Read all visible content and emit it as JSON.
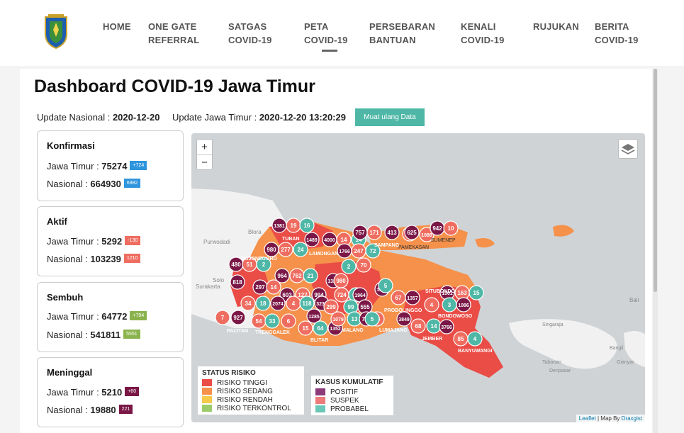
{
  "nav": {
    "items": [
      {
        "line1": "HOME",
        "line2": ""
      },
      {
        "line1": "ONE GATE",
        "line2": "REFERRAL"
      },
      {
        "line1": "SATGAS",
        "line2": "COVID-19"
      },
      {
        "line1": "PETA",
        "line2": "COVID-19"
      },
      {
        "line1": "PERSEBARAN",
        "line2": "BANTUAN"
      },
      {
        "line1": "KENALI",
        "line2": "COVID-19"
      },
      {
        "line1": "RUJUKAN",
        "line2": ""
      },
      {
        "line1": "BERITA",
        "line2": "COVID-19"
      }
    ]
  },
  "page": {
    "title": "Dashboard COVID-19 Jawa Timur",
    "update_nasional_label": "Update Nasional : ",
    "update_nasional_value": "2020-12-20",
    "update_jatim_label": "Update Jawa Timur : ",
    "update_jatim_value": "2020-12-20 13:20:29",
    "reload_label": "Muat ulang Data"
  },
  "cards": [
    {
      "title": "Konfirmasi",
      "jatim_label": "Jawa Timur : ",
      "jatim_value": "75274",
      "jatim_delta": "+724",
      "nas_label": "Nasional : ",
      "nas_value": "664930",
      "nas_delta": "6982",
      "color": "#2f95dc"
    },
    {
      "title": "Aktif",
      "jatim_label": "Jawa Timur : ",
      "jatim_value": "5292",
      "jatim_delta": "-130",
      "nas_label": "Nasional : ",
      "nas_value": "103239",
      "nas_delta": "1210",
      "color": "#ef6d60"
    },
    {
      "title": "Sembuh",
      "jatim_label": "Jawa Timur : ",
      "jatim_value": "64772",
      "jatim_delta": "+794",
      "nas_label": "Nasional : ",
      "nas_value": "541811",
      "nas_delta": "5551",
      "color": "#8bb34d"
    },
    {
      "title": "Meninggal",
      "jatim_label": "Jawa Timur : ",
      "jatim_value": "5210",
      "jatim_delta": "+60",
      "nas_label": "Nasional : ",
      "nas_value": "19880",
      "nas_delta": "221",
      "color": "#7a1746"
    }
  ],
  "map": {
    "zoom_in": "+",
    "zoom_out": "−",
    "attribution_leaflet": "Leaflet",
    "attribution_sep": " | Map By ",
    "attribution_draxgist": "Draxgist",
    "labels": {
      "blora": "Blora",
      "purwodadi": "Purwodadi",
      "solo": "Solo",
      "surakarta": "Surakarta",
      "bali": "Bali",
      "singaraja": "Singaraja",
      "tabanan": "Tabanan",
      "denpasar": "Denpasar",
      "bangli": "Bangli",
      "gianyar": "Gianyar",
      "sumenep": "SUMENEP",
      "pamekasan": "PAMEKASAN",
      "tuban": "TUBAN",
      "lamongan": "LAMONGAN",
      "bojonegoro": "BOJONEGORO",
      "pacitan": "PACITAN",
      "trenggalek": "TRENGGALEK",
      "blitar": "BLITAR",
      "malang": "MALANG",
      "lumajang": "LUMAJANG",
      "jember": "JEMBER",
      "banyuwangi": "BANYUWANGI",
      "bondowoso": "BONDOWOSO",
      "probolinggo": "PROBOLINGGO",
      "sampang": "SAMPANG",
      "situbondo": "SITUBONDO"
    },
    "clusters": [
      {
        "v": "1381",
        "t": "positif"
      },
      {
        "v": "19",
        "t": "suspek"
      },
      {
        "v": "16",
        "t": "probabel"
      },
      {
        "v": "1489",
        "t": "positif"
      },
      {
        "v": "4000",
        "t": "positif"
      },
      {
        "v": "14",
        "t": "suspek"
      },
      {
        "v": "14",
        "t": "probabel"
      },
      {
        "v": "757",
        "t": "positif"
      },
      {
        "v": "171",
        "t": "suspek"
      },
      {
        "v": "413",
        "t": "positif"
      },
      {
        "v": "26",
        "t": "suspek"
      },
      {
        "v": "625",
        "t": "positif"
      },
      {
        "v": "1088",
        "t": "suspek"
      },
      {
        "v": "942",
        "t": "positif"
      },
      {
        "v": "10",
        "t": "suspek"
      },
      {
        "v": "980",
        "t": "positif"
      },
      {
        "v": "277",
        "t": "suspek"
      },
      {
        "v": "24",
        "t": "probabel"
      },
      {
        "v": "1766",
        "t": "positif"
      },
      {
        "v": "247",
        "t": "suspek"
      },
      {
        "v": "72",
        "t": "probabel"
      },
      {
        "v": "480",
        "t": "positif"
      },
      {
        "v": "51",
        "t": "suspek"
      },
      {
        "v": "2",
        "t": "probabel"
      },
      {
        "v": "2",
        "t": "probabel"
      },
      {
        "v": "70",
        "t": "suspek"
      },
      {
        "v": "818",
        "t": "positif"
      },
      {
        "v": "964",
        "t": "positif"
      },
      {
        "v": "762",
        "t": "suspek"
      },
      {
        "v": "21",
        "t": "probabel"
      },
      {
        "v": "297",
        "t": "positif"
      },
      {
        "v": "14",
        "t": "suspek"
      },
      {
        "v": "1322",
        "t": "positif"
      },
      {
        "v": "980",
        "t": "suspek"
      },
      {
        "v": "1238",
        "t": "positif"
      },
      {
        "v": "5",
        "t": "probabel"
      },
      {
        "v": "1501",
        "t": "positif"
      },
      {
        "v": "163",
        "t": "suspek"
      },
      {
        "v": "15",
        "t": "probabel"
      },
      {
        "v": "603",
        "t": "positif"
      },
      {
        "v": "127",
        "t": "suspek"
      },
      {
        "v": "994",
        "t": "positif"
      },
      {
        "v": "724",
        "t": "suspek"
      },
      {
        "v": "68",
        "t": "probabel"
      },
      {
        "v": "1964",
        "t": "positif"
      },
      {
        "v": "67",
        "t": "suspek"
      },
      {
        "v": "1357",
        "t": "positif"
      },
      {
        "v": "4",
        "t": "suspek"
      },
      {
        "v": "3",
        "t": "probabel"
      },
      {
        "v": "1086",
        "t": "positif"
      },
      {
        "v": "34",
        "t": "suspek"
      },
      {
        "v": "18",
        "t": "probabel"
      },
      {
        "v": "2074",
        "t": "positif"
      },
      {
        "v": "4",
        "t": "suspek"
      },
      {
        "v": "118",
        "t": "probabel"
      },
      {
        "v": "3233",
        "t": "positif"
      },
      {
        "v": "299",
        "t": "suspek"
      },
      {
        "v": "99",
        "t": "probabel"
      },
      {
        "v": "555",
        "t": "positif"
      },
      {
        "v": "7",
        "t": "suspek"
      },
      {
        "v": "927",
        "t": "positif"
      },
      {
        "v": "54",
        "t": "suspek"
      },
      {
        "v": "33",
        "t": "probabel"
      },
      {
        "v": "6",
        "t": "suspek"
      },
      {
        "v": "1285",
        "t": "positif"
      },
      {
        "v": "15",
        "t": "suspek"
      },
      {
        "v": "64",
        "t": "probabel"
      },
      {
        "v": "1352",
        "t": "positif"
      },
      {
        "v": "1079",
        "t": "suspek"
      },
      {
        "v": "13",
        "t": "probabel"
      },
      {
        "v": "720",
        "t": "positif"
      },
      {
        "v": "25",
        "t": "suspek"
      },
      {
        "v": "5",
        "t": "probabel"
      },
      {
        "v": "3849",
        "t": "positif"
      },
      {
        "v": "68",
        "t": "suspek"
      },
      {
        "v": "14",
        "t": "probabel"
      },
      {
        "v": "3766",
        "t": "positif"
      },
      {
        "v": "85",
        "t": "suspek"
      },
      {
        "v": "4",
        "t": "probabel"
      }
    ]
  },
  "legend_status": {
    "title": "STATUS RISIKO",
    "items": [
      {
        "label": "RISIKO TINGGI",
        "color": "#ea4c46"
      },
      {
        "label": "RISIKO SEDANG",
        "color": "#f5914a"
      },
      {
        "label": "RISIKO RENDAH",
        "color": "#f5c94a"
      },
      {
        "label": "RISIKO TERKONTROL",
        "color": "#9ccc6a"
      }
    ]
  },
  "legend_kasus": {
    "title": "KASUS KUMULATIF",
    "items": [
      {
        "label": "POSITIF",
        "color": "#8c3a7a"
      },
      {
        "label": "SUSPEK",
        "color": "#ee7a7a"
      },
      {
        "label": "PROBABEL",
        "color": "#6bc7b8"
      }
    ]
  },
  "colors": {
    "positif": "#7a1746",
    "suspek": "#ef6d60",
    "probabel": "#4fb7a6",
    "risk_high": "#ea4c46",
    "risk_mid": "#f5914a",
    "accent": "#4fb7a6"
  }
}
